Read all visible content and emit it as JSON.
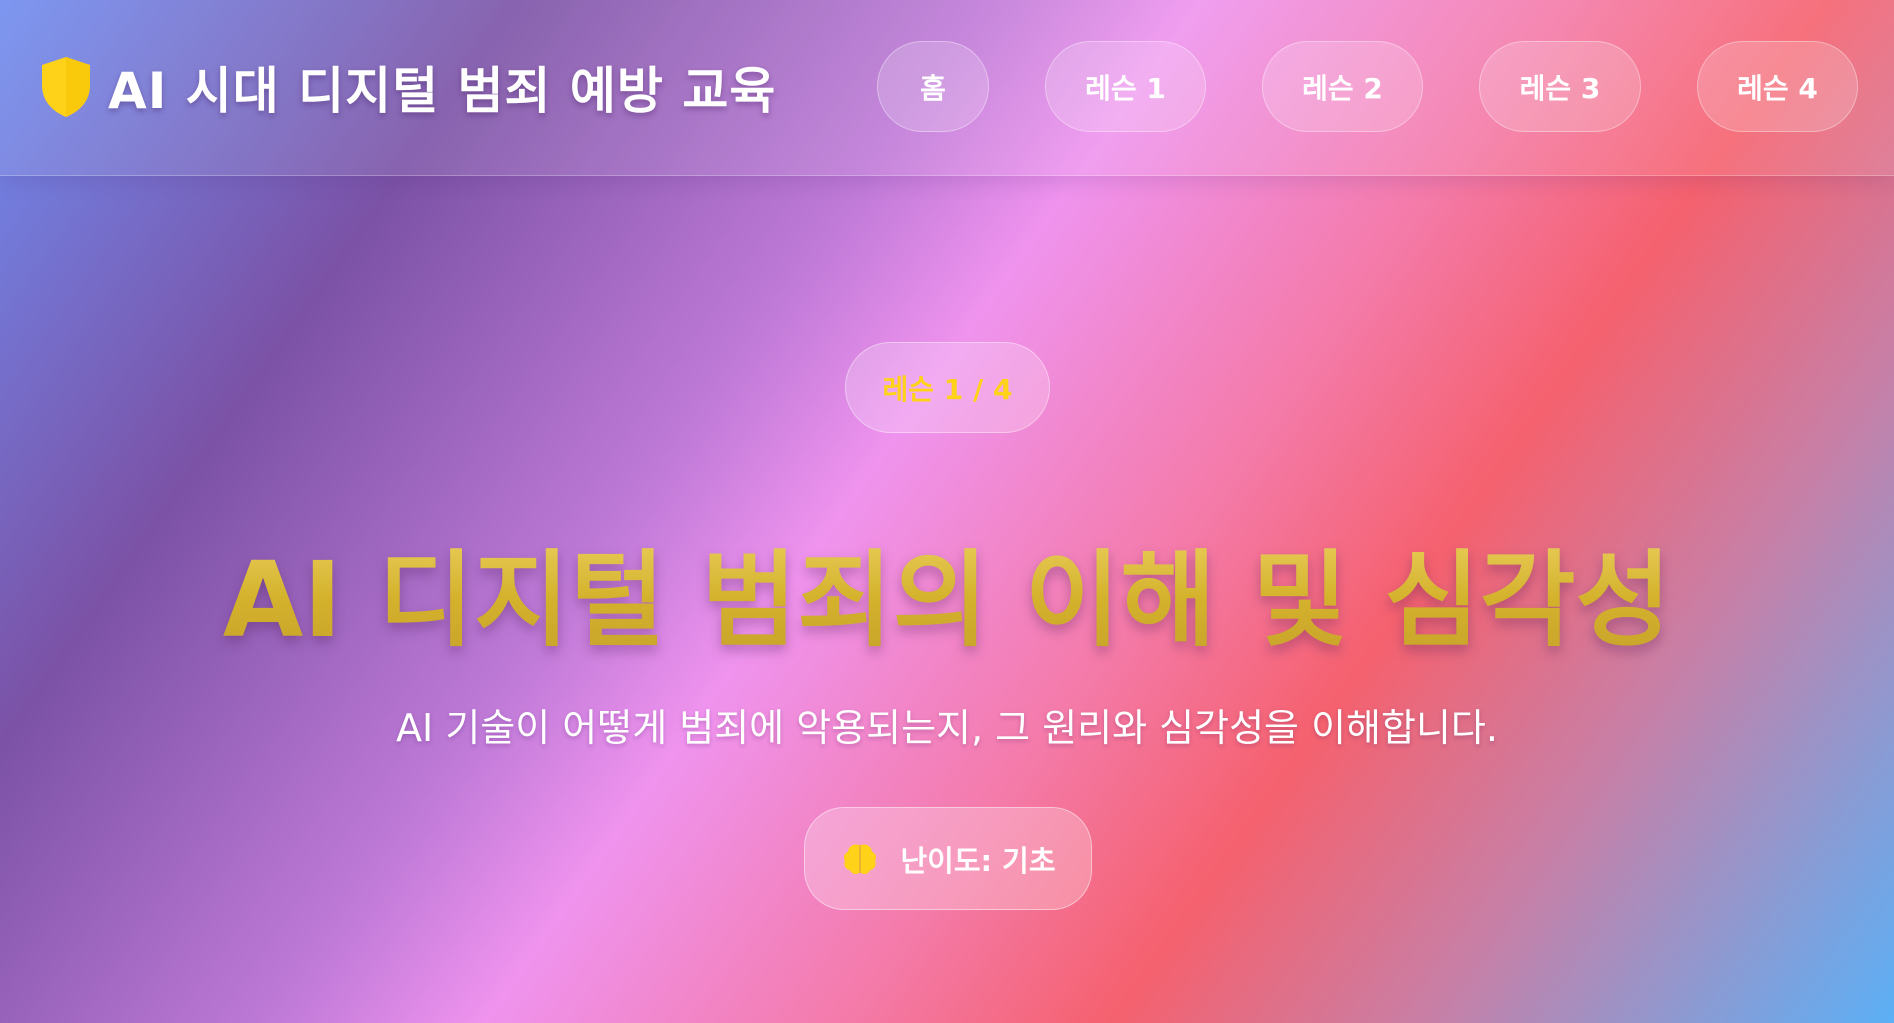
{
  "header": {
    "title": "AI 시대 디지털 범죄 예방 교육",
    "logo_icon": "shield-icon",
    "logo_color": "#ffd21a",
    "nav": [
      {
        "label": "홈"
      },
      {
        "label": "레슨 1"
      },
      {
        "label": "레슨 2"
      },
      {
        "label": "레슨 3"
      },
      {
        "label": "레슨 4"
      }
    ]
  },
  "hero": {
    "badge": "레슨 1 / 4",
    "title": "AI 디지털 범죄의 이해 및 심각성",
    "subtitle": "AI 기술이 어떻게 범죄에 악용되는지, 그 원리와 심각성을 이해합니다.",
    "difficulty_icon": "brain-icon",
    "difficulty_label": "난이도: 기초"
  },
  "colors": {
    "accent_gold": "#ffd21a",
    "title_gold": "#d4b22c"
  }
}
